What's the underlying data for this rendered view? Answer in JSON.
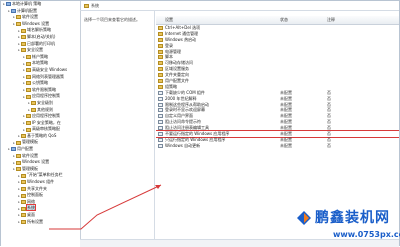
{
  "tree": {
    "items": [
      {
        "label": "本地计算机 策略",
        "indent": 0,
        "icon": "pc"
      },
      {
        "label": "计算机配置",
        "indent": 1,
        "icon": "pc"
      },
      {
        "label": "软件设置",
        "indent": 2
      },
      {
        "label": "Windows 设置",
        "indent": 2
      },
      {
        "label": "域名解析策略",
        "indent": 3
      },
      {
        "label": "脚本(启动/关机)",
        "indent": 3
      },
      {
        "label": "已部署的打印机",
        "indent": 3
      },
      {
        "label": "安全设置",
        "indent": 3
      },
      {
        "label": "帐户策略",
        "indent": 4
      },
      {
        "label": "本地策略",
        "indent": 4
      },
      {
        "label": "高级安全 Windows",
        "indent": 4
      },
      {
        "label": "网络列表管理器策",
        "indent": 4
      },
      {
        "label": "公钥策略",
        "indent": 4
      },
      {
        "label": "软件限制策略",
        "indent": 4
      },
      {
        "label": "应用程序控制策",
        "indent": 4
      },
      {
        "label": "安全级别",
        "indent": 5
      },
      {
        "label": "其他规则",
        "indent": 5
      },
      {
        "label": "应用程序控制策",
        "indent": 4
      },
      {
        "label": "IP 安全策略，在",
        "indent": 4
      },
      {
        "label": "高级审核策略配",
        "indent": 4
      },
      {
        "label": "基于策略的 QoS",
        "indent": 3
      },
      {
        "label": "管理模板",
        "indent": 2
      },
      {
        "label": "用户配置",
        "indent": 1,
        "icon": "pc"
      },
      {
        "label": "软件设置",
        "indent": 2
      },
      {
        "label": "Windows 设置",
        "indent": 2
      },
      {
        "label": "管理模板",
        "indent": 2
      },
      {
        "label": "\"开始\"菜单和任务栏",
        "indent": 3
      },
      {
        "label": "Windows 组件",
        "indent": 3
      },
      {
        "label": "共享文件夹",
        "indent": 3
      },
      {
        "label": "控制面板",
        "indent": 3
      },
      {
        "label": "网络",
        "indent": 3
      },
      {
        "label": "系统",
        "indent": 3,
        "selected": true
      },
      {
        "label": "桌面",
        "indent": 3
      },
      {
        "label": "所有设置",
        "indent": 3
      }
    ]
  },
  "pane": {
    "breadcrumb": "系统",
    "description": "选择一个项目来查看它的描述。",
    "columns": {
      "setting": "设置",
      "state": "状态",
      "comment": "注释"
    },
    "rows": [
      {
        "name": "Ctrl+Alt+Del 选项",
        "type": "folder",
        "state": "",
        "comment": ""
      },
      {
        "name": "Internet 通信管理",
        "type": "folder",
        "state": "",
        "comment": ""
      },
      {
        "name": "Windows 热启动",
        "type": "folder",
        "state": "",
        "comment": ""
      },
      {
        "name": "登录",
        "type": "folder",
        "state": "",
        "comment": ""
      },
      {
        "name": "电源管理",
        "type": "folder",
        "state": "",
        "comment": ""
      },
      {
        "name": "脚本",
        "type": "folder",
        "state": "",
        "comment": ""
      },
      {
        "name": "可移动存储访问",
        "type": "folder",
        "state": "",
        "comment": ""
      },
      {
        "name": "区域设置服务",
        "type": "folder",
        "state": "",
        "comment": ""
      },
      {
        "name": "文件夹重定向",
        "type": "folder",
        "state": "",
        "comment": ""
      },
      {
        "name": "用户配置文件",
        "type": "folder",
        "state": "",
        "comment": ""
      },
      {
        "name": "组策略",
        "type": "folder",
        "state": "",
        "comment": ""
      },
      {
        "name": "下载缺少的 COM 组件",
        "type": "setting",
        "state": "未配置",
        "comment": "否"
      },
      {
        "name": "2000 年世纪解释",
        "type": "setting",
        "state": "未配置",
        "comment": "否"
      },
      {
        "name": "限制这些程序从帮助启动",
        "type": "setting",
        "state": "未配置",
        "comment": "否"
      },
      {
        "name": "登录时不显示欢迎屏幕",
        "type": "setting",
        "state": "未配置",
        "comment": "否"
      },
      {
        "name": "自定义用户界面",
        "type": "setting",
        "state": "未配置",
        "comment": "否"
      },
      {
        "name": "阻止访问命令提示符",
        "type": "setting",
        "state": "未配置",
        "comment": "否"
      },
      {
        "name": "阻止访问注册表编辑工具",
        "type": "setting",
        "state": "未配置",
        "comment": "否"
      },
      {
        "name": "不要运行指定的 Windows 应用程序",
        "type": "setting",
        "state": "未配置",
        "comment": "否",
        "highlight": true
      },
      {
        "name": "只运行指定的 Windows 应用程序",
        "type": "setting",
        "state": "未配置",
        "comment": "否"
      },
      {
        "name": "Windows 自动更新",
        "type": "setting",
        "state": "未配置",
        "comment": "否"
      }
    ]
  },
  "watermark": {
    "brand": "鹏鑫装机网",
    "url": "www.0753px.com"
  },
  "colors": {
    "accent_red": "#d73a3a",
    "watermark_blue": "#1a5ec9"
  }
}
